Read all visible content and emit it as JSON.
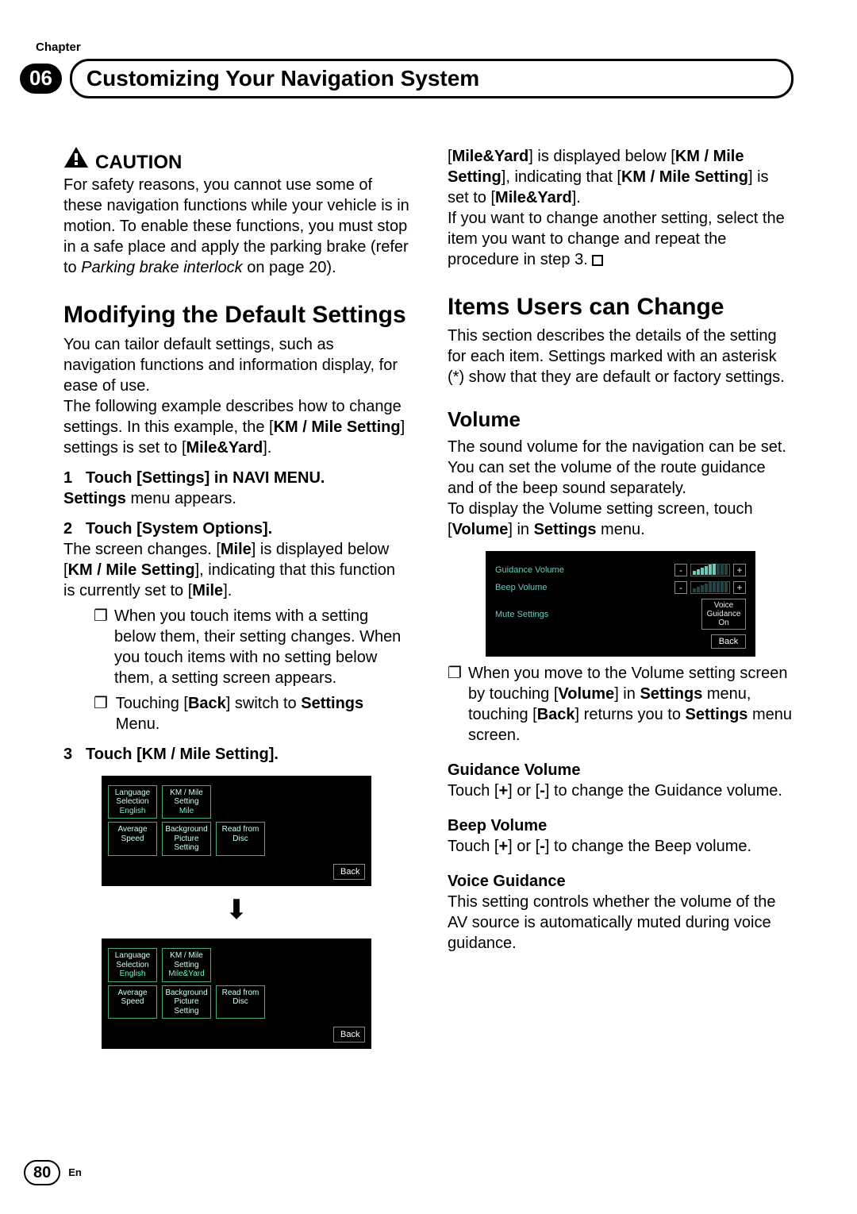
{
  "chapterLabel": "Chapter",
  "chapterNum": "06",
  "pageTitle": "Customizing Your Navigation System",
  "caution": {
    "heading": "CAUTION",
    "body": "For safety reasons, you cannot use some of these navigation functions while your vehicle is in motion. To enable these functions, you must stop in a safe place and apply the parking brake (refer to ",
    "ref": "Parking brake interlock",
    "refTail": " on page 20)."
  },
  "modSection": {
    "title": "Modifying the Default Settings",
    "p1a": "You can tailor default settings, such as navigation functions and information display, for ease of use.",
    "p1b_pre": "The following example describes how to change settings. In this example, the [",
    "p1b_b1": "KM / Mile Setting",
    "p1b_mid": "] settings is set to [",
    "p1b_b2": "Mile&Yard",
    "p1b_post": "].",
    "steps": [
      {
        "num": "1",
        "bold": "Touch [Settings] in NAVI MENU."
      },
      {
        "sub_b": "Settings",
        "sub_t": " menu appears."
      },
      {
        "num": "2",
        "bold": "Touch [System Options]."
      },
      {
        "p_pre": "The screen changes. [",
        "p_b1": "Mile",
        "p_mid1": "] is displayed below [",
        "p_b2": "KM / Mile Setting",
        "p_mid2": "], indicating that this function is currently set to [",
        "p_b3": "Mile",
        "p_post": "]."
      },
      {
        "bullet": "When you touch items with a setting below them, their setting changes. When you touch items with no setting below them, a setting screen appears."
      },
      {
        "bullet_pre": "Touching [",
        "bullet_b1": "Back",
        "bullet_mid": "] switch to ",
        "bullet_b2": "Settings",
        "bullet_post": " Menu."
      },
      {
        "num": "3",
        "bold": "Touch [KM / Mile Setting]."
      }
    ],
    "shot1": {
      "cells": [
        [
          "Language Selection",
          "English"
        ],
        [
          "KM / Mile Setting",
          "Mile"
        ],
        [
          "Average Speed",
          ""
        ],
        [
          "Background Picture Setting",
          ""
        ],
        [
          "Read from Disc",
          ""
        ]
      ],
      "back": "Back"
    },
    "shot2": {
      "cells": [
        [
          "Language Selection",
          "English"
        ],
        [
          "KM / Mile Setting",
          "Mile&Yard"
        ],
        [
          "Average Speed",
          ""
        ],
        [
          "Background Picture Setting",
          ""
        ],
        [
          "Read from Disc",
          ""
        ]
      ],
      "back": "Back"
    }
  },
  "colR_top": {
    "pre": "[",
    "b1": "Mile&Yard",
    "mid1": "] is displayed below [",
    "b2": "KM / Mile Setting",
    "mid2": "], indicating that [",
    "b3": "KM / Mile Setting",
    "mid3": "] is set to [",
    "b4": "Mile&Yard",
    "post": "].",
    "p2": "If you want to change another setting, select the item you want to change and repeat the procedure in step 3."
  },
  "items": {
    "title": "Items Users can Change",
    "body": "This section describes the details of the setting for each item. Settings marked with an asterisk (*) show that they are default or factory settings."
  },
  "volume": {
    "h": "Volume",
    "p1": "The sound volume for the navigation can be set. You can set the volume of the route guidance and of the beep sound separately.",
    "p2_pre": "To display the Volume setting screen, touch [",
    "p2_b1": "Volume",
    "p2_mid": "] in ",
    "p2_b2": "Settings",
    "p2_post": " menu.",
    "shot": {
      "rows": [
        {
          "label": "Guidance Volume",
          "type": "slider"
        },
        {
          "label": "Beep Volume",
          "type": "slider"
        },
        {
          "label": "Mute Settings",
          "type": "vg",
          "box1": "Voice Guidance",
          "box2": "On"
        }
      ],
      "back": "Back"
    },
    "bullet_pre": "When you move to the Volume setting screen by touching [",
    "bullet_b1": "Volume",
    "bullet_mid1": "] in ",
    "bullet_b2": "Settings",
    "bullet_mid2": " menu, touching [",
    "bullet_b3": "Back",
    "bullet_mid3": "] returns you to ",
    "bullet_b4": "Settings",
    "bullet_post": " menu screen.",
    "gv_h": "Guidance Volume",
    "gv_pre": "Touch [",
    "gv_b1": "+",
    "gv_mid": "] or [",
    "gv_b2": "-",
    "gv_post": "] to change the Guidance volume.",
    "bv_h": "Beep Volume",
    "bv_pre": "Touch [",
    "bv_b1": "+",
    "bv_mid": "] or [",
    "bv_b2": "-",
    "bv_post": "] to change the Beep volume.",
    "vg_h": "Voice Guidance",
    "vg_body": "This setting controls whether the volume of the AV source is automatically muted during voice guidance."
  },
  "footer": {
    "page": "80",
    "lang": "En"
  }
}
